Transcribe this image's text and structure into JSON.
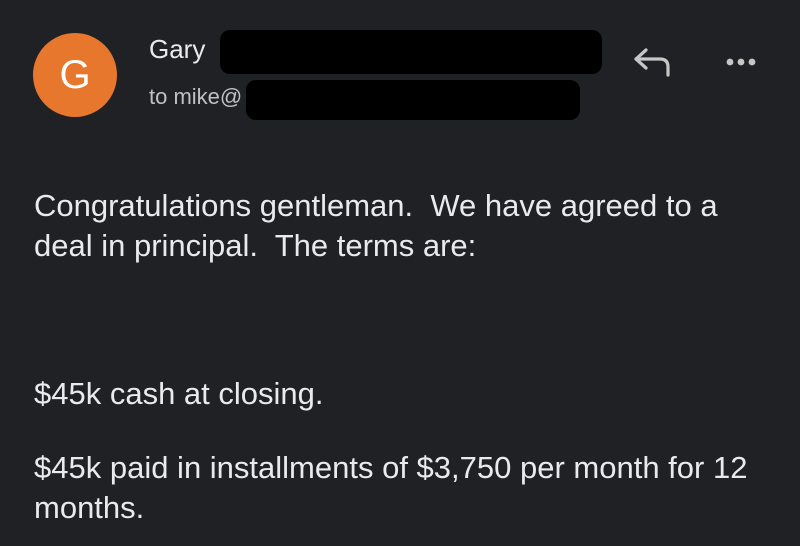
{
  "email": {
    "sender": {
      "avatar_letter": "G",
      "avatar_color": "#e8772e",
      "name_visible": "Gary",
      "to_visible": "to mike@"
    },
    "actions": {
      "reply_icon": "reply-arrow-icon",
      "more_icon": "more-options-dots-icon"
    },
    "body": {
      "paragraphs": [
        "Congratulations gentleman.  We have agreed to a deal in principal.  The terms are:",
        "$45k cash at closing.",
        "$45k paid in installments of $3,750 per month for 12 months."
      ]
    }
  },
  "colors": {
    "background": "#202124",
    "text": "#e8eaed",
    "secondary_text": "#bdc1c6",
    "redaction": "#000000"
  }
}
